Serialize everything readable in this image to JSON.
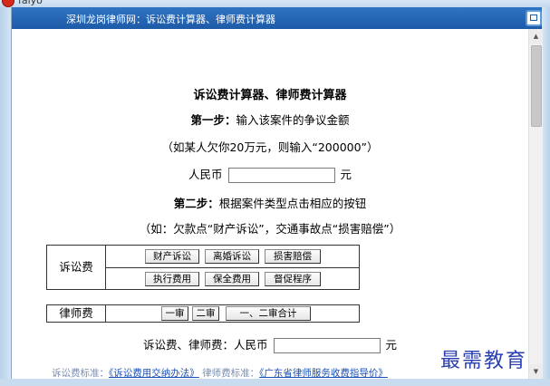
{
  "window": {
    "title": "falyo",
    "header_title": "深圳龙岗律师网：诉讼费计算器、律师费计算器"
  },
  "main": {
    "title": "诉讼费计算器、律师费计算器",
    "step1_label": "第一步：",
    "step1_text": "输入该案件的争议金额",
    "example1": "（如某人欠你20万元，则输入“200000”）",
    "amount_prefix": "人民币",
    "amount_value": "",
    "amount_unit": "元",
    "step2_label": "第二步：",
    "step2_text": "根据案件类型点击相应的按钮",
    "example2": "（如：欠款点“财产诉讼”，交通事故点“损害赔偿”）"
  },
  "litigation": {
    "label": "诉讼费",
    "buttons": [
      "财产诉讼",
      "离婚诉讼",
      "损害赔偿",
      "执行费用",
      "保全费用",
      "督促程序"
    ]
  },
  "lawyer": {
    "label": "律师费",
    "buttons": [
      "一审",
      "二审",
      "一、二审合计"
    ]
  },
  "total": {
    "label": "诉讼费、律师费：人民币",
    "value": "",
    "unit": "元"
  },
  "footer": {
    "text1": "诉讼费标准：",
    "link1": "《诉讼费用交纳办法》",
    "text2": "律师费标准：",
    "link2": "《广东省律师服务收费指导价》"
  },
  "watermark": "最需教育"
}
